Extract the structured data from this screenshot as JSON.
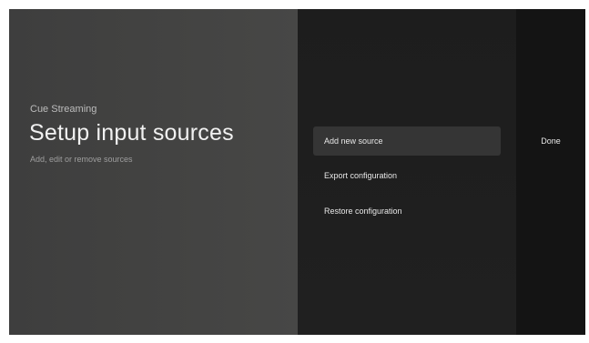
{
  "header": {
    "eyebrow": "Cue Streaming",
    "title": "Setup input sources",
    "subtitle": "Add, edit or remove sources"
  },
  "menu": {
    "items": [
      {
        "label": "Add new source",
        "focused": true
      },
      {
        "label": "Export configuration",
        "focused": false
      },
      {
        "label": "Restore configuration",
        "focused": false
      }
    ]
  },
  "actions": {
    "done_label": "Done"
  },
  "colors": {
    "left_panel": "#424241",
    "middle_panel": "#1f1f1f",
    "right_panel": "#141414",
    "focused_item": "#353535",
    "text_primary": "#f1f1f1",
    "text_secondary": "#9e9e9e"
  }
}
